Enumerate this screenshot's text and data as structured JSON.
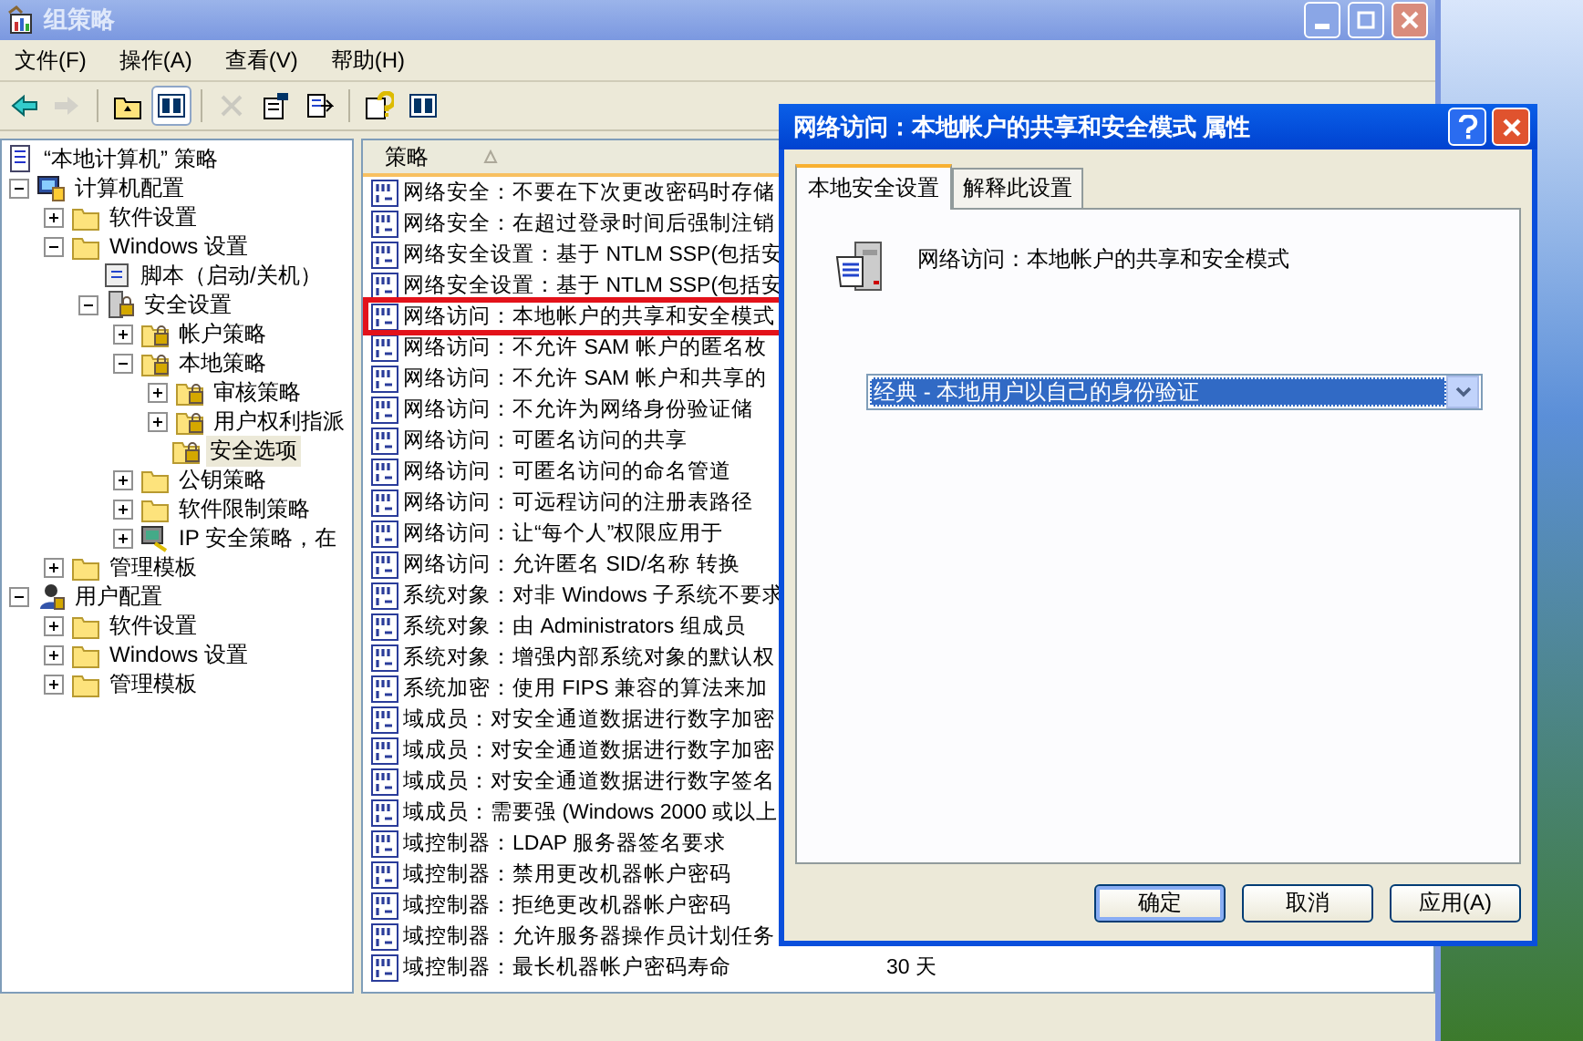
{
  "window": {
    "title": "组策略"
  },
  "menu": [
    "文件(F)",
    "操作(A)",
    "查看(V)",
    "帮助(H)"
  ],
  "toolbar": [
    {
      "disabled": false,
      "pressed": false
    },
    {
      "disabled": true,
      "pressed": false
    },
    {
      "disabled": false,
      "pressed": false
    },
    {
      "disabled": false,
      "pressed": true
    },
    {
      "disabled": true,
      "pressed": false
    },
    {
      "disabled": false,
      "pressed": false
    },
    {
      "disabled": false,
      "pressed": false
    },
    {
      "disabled": false,
      "pressed": false
    },
    {
      "disabled": false,
      "pressed": false
    }
  ],
  "tree": [
    {
      "label": "“本地计算机” 策略",
      "kind": "policy",
      "selected": false,
      "children": [
        {
          "label": "计算机配置",
          "kind": "computer",
          "expanded": true,
          "selected": false,
          "children": [
            {
              "label": "软件设置",
              "kind": "folder",
              "expanded": false,
              "selected": false
            },
            {
              "label": "Windows 设置",
              "kind": "folder",
              "expanded": true,
              "selected": false,
              "children": [
                {
                  "label": "脚本（启动/关机）",
                  "kind": "script",
                  "selected": false
                },
                {
                  "label": "安全设置",
                  "kind": "secure",
                  "expanded": true,
                  "selected": false,
                  "children": [
                    {
                      "label": "帐户策略",
                      "kind": "lock",
                      "expanded": false,
                      "selected": false
                    },
                    {
                      "label": "本地策略",
                      "kind": "lock",
                      "expanded": true,
                      "selected": false,
                      "children": [
                        {
                          "label": "审核策略",
                          "kind": "lock",
                          "expanded": false,
                          "selected": false
                        },
                        {
                          "label": "用户权利指派",
                          "kind": "lock",
                          "expanded": false,
                          "selected": false
                        },
                        {
                          "label": "安全选项",
                          "kind": "lock",
                          "selected": true
                        }
                      ]
                    },
                    {
                      "label": "公钥策略",
                      "kind": "folder",
                      "expanded": false,
                      "selected": false
                    },
                    {
                      "label": "软件限制策略",
                      "kind": "folder",
                      "expanded": false,
                      "selected": false
                    },
                    {
                      "label": "IP 安全策略，在",
                      "kind": "ip",
                      "expanded": false,
                      "selected": false
                    }
                  ]
                }
              ]
            },
            {
              "label": "管理模板",
              "kind": "folder",
              "expanded": false,
              "selected": false
            }
          ]
        },
        {
          "label": "用户配置",
          "kind": "user",
          "expanded": true,
          "selected": false,
          "children": [
            {
              "label": "软件设置",
              "kind": "folder",
              "expanded": false,
              "selected": false
            },
            {
              "label": "Windows 设置",
              "kind": "folder",
              "expanded": false,
              "selected": false
            },
            {
              "label": "管理模板",
              "kind": "folder",
              "expanded": false,
              "selected": false
            }
          ]
        }
      ]
    }
  ],
  "list": {
    "columns": [
      {
        "label": "策略",
        "sorted": true
      }
    ],
    "rows": [
      {
        "policy": "网络安全：不要在下次更改密码时存储"
      },
      {
        "policy": "网络安全：在超过登录时间后强制注销"
      },
      {
        "policy": "网络安全设置：基于 NTLM SSP(包括安"
      },
      {
        "policy": "网络安全设置：基于 NTLM SSP(包括安"
      },
      {
        "policy": "网络访问：本地帐户的共享和安全模式"
      },
      {
        "policy": "网络访问：不允许 SAM 帐户的匿名枚"
      },
      {
        "policy": "网络访问：不允许 SAM 帐户和共享的"
      },
      {
        "policy": "网络访问：不允许为网络身份验证储"
      },
      {
        "policy": "网络访问：可匿名访问的共享"
      },
      {
        "policy": "网络访问：可匿名访问的命名管道"
      },
      {
        "policy": "网络访问：可远程访问的注册表路径"
      },
      {
        "policy": "网络访问：让“每个人”权限应用于"
      },
      {
        "policy": "网络访问：允许匿名 SID/名称 转换"
      },
      {
        "policy": "系统对象：对非 Windows 子系统不要求"
      },
      {
        "policy": "系统对象：由 Administrators 组成员"
      },
      {
        "policy": "系统对象：增强内部系统对象的默认权"
      },
      {
        "policy": "系统加密：使用 FIPS 兼容的算法来加"
      },
      {
        "policy": "域成员：对安全通道数据进行数字加密"
      },
      {
        "policy": "域成员：对安全通道数据进行数字加密"
      },
      {
        "policy": "域成员：对安全通道数据进行数字签名"
      },
      {
        "policy": "域成员：需要强 (Windows 2000 或以上"
      },
      {
        "policy": "域控制器：LDAP 服务器签名要求"
      },
      {
        "policy": "域控制器：禁用更改机器帐户密码"
      },
      {
        "policy": "域控制器：拒绝更改机器帐户密码"
      },
      {
        "policy": "域控制器：允许服务器操作员计划任务"
      },
      {
        "policy": "域控制器：最长机器帐户密码寿命",
        "setting": "30 天"
      }
    ]
  },
  "dialog": {
    "title": "网络访问：本地帐户的共享和安全模式 属性",
    "tabs": [
      {
        "label": "本地安全设置",
        "selected": true
      },
      {
        "label": "解释此设置",
        "selected": false
      }
    ],
    "policy_name": "网络访问：本地帐户的共享和安全模式",
    "dropdown": {
      "value": "经典 - 本地用户以自己的身份验证",
      "focused": true
    },
    "buttons": [
      {
        "label": "确定",
        "default": true
      },
      {
        "label": "取消",
        "default": false
      },
      {
        "label": "应用(A)",
        "default": false
      }
    ]
  }
}
